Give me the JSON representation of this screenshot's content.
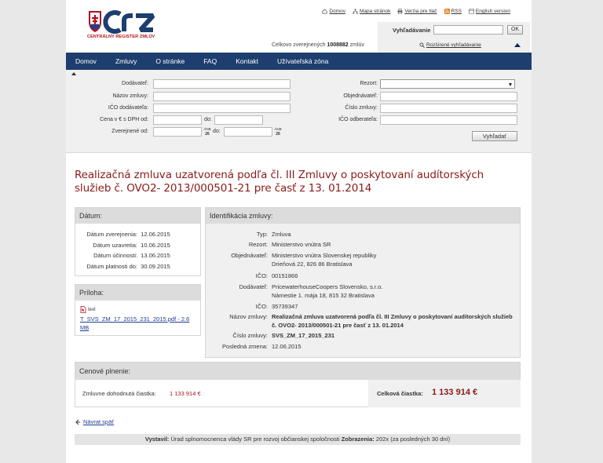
{
  "header": {
    "logo_text": "CENTRÁLNY REGISTER ZMLÚV",
    "top_links": [
      {
        "label": "Domov",
        "icon": "home-icon"
      },
      {
        "label": "Mapa stránok",
        "icon": "sitemap-icon"
      },
      {
        "label": "Verzia pre tlač",
        "icon": "print-icon"
      },
      {
        "label": "RSS",
        "icon": "rss-icon"
      },
      {
        "label": "English version",
        "icon": "language-icon"
      }
    ],
    "counter_label": "Celkovo zverejnených",
    "counter_value": "1008882",
    "counter_unit": "zmlúv"
  },
  "search": {
    "label": "Vyhľadávanie",
    "value": "",
    "button": "OK",
    "advanced_link": "Rozšírené vyhľadávanie"
  },
  "nav": [
    "Domov",
    "Zmluvy",
    "O stránke",
    "FAQ",
    "Kontakt",
    "Užívateľská zóna"
  ],
  "filter": {
    "dodavatel": "Dodávateľ:",
    "nazov": "Názov zmluvy:",
    "ico_dod": "IČO dodávateľa:",
    "cena": "Cena v € s DPH od:",
    "cena_do": "do:",
    "zverejnene": "Zverejnené od:",
    "zverejnene_do": "do:",
    "rezort": "Rezort:",
    "objednavatel": "Objednávateľ:",
    "cislo": "Číslo zmluvy:",
    "ico_odb": "IČO odberateľa:",
    "cal_top": "ÁNB",
    "cal_num": "26",
    "button": "Vyhľadať"
  },
  "title": "Realizačná zmluva uzatvorená podľa čl. III Zmluvy o poskytovaní audítorských služieb č. OVO2- 2013/000501-21 pre časť z 13. 01.2014",
  "datum": {
    "heading": "Dátum:",
    "rows": [
      {
        "k": "Dátum zverejnenia:",
        "v": "12.06.2015"
      },
      {
        "k": "Dátum uzavretia:",
        "v": "10.06.2015"
      },
      {
        "k": "Dátum účinnosti:",
        "v": "13.06.2015"
      },
      {
        "k": "Dátum platnosti do:",
        "v": "30.09.2015"
      }
    ]
  },
  "priloha": {
    "heading": "Príloha:",
    "type": "text",
    "file": "T_SVS_ZM_17_2015_231_2015.pdf - 2.6 MB"
  },
  "ident": {
    "heading": "Identifikácia zmluvy:",
    "typ_k": "Typ:",
    "typ_v": "Zmluva",
    "rezort_k": "Rezort:",
    "rezort_v": "Ministerstvo vnútra SR",
    "obj_k": "Objednávateľ:",
    "obj_v1": "Ministerstvo vnútra Slovenskej republiky",
    "obj_v2": "Drieňová 22, 826 86 Bratislava",
    "ico1_k": "IČO:",
    "ico1_v": "00151866",
    "dod_k": "Dodávateľ:",
    "dod_v1": "PricewaterhouseCoopers Slovensko, s.r.o.",
    "dod_v2": "Námestie 1. mája 18, 815 32 Bratislava",
    "ico2_k": "IČO:",
    "ico2_v": "35739347",
    "nazov_k": "Názov zmluvy:",
    "nazov_v": "Realizačná zmluva uzatvorená podľa čl. III Zmluvy o poskytovaní audítorských služieb č. OVO2- 2013/000501-21 pre časť z 13. 01.2014",
    "cislo_k": "Číslo zmluvy:",
    "cislo_v": "SVS_ZM_17_2015_231",
    "zmena_k": "Posledná zmena:",
    "zmena_v": "12.06.2015"
  },
  "cena": {
    "heading": "Cenové plnenie:",
    "label": "Zmluvne dohodnutá čiastka:",
    "value": "1 133 914 €",
    "total_label": "Celková čiastka:",
    "total_value": "1 133 914 €"
  },
  "back": "Návrat späť",
  "footer": {
    "vystavil_label": "Vystavil:",
    "vystavil_value": "Úrad splnomocnenca vlády SR pre rozvoj občianskej spoločnosti",
    "zobrazenia_label": "Zobrazenia:",
    "zobrazenia_value": "202x (za posledných 30 dní)"
  },
  "colors": {
    "nav": "#1d3e6e",
    "title": "#8b1a1a",
    "accent_red": "#b0121d"
  }
}
